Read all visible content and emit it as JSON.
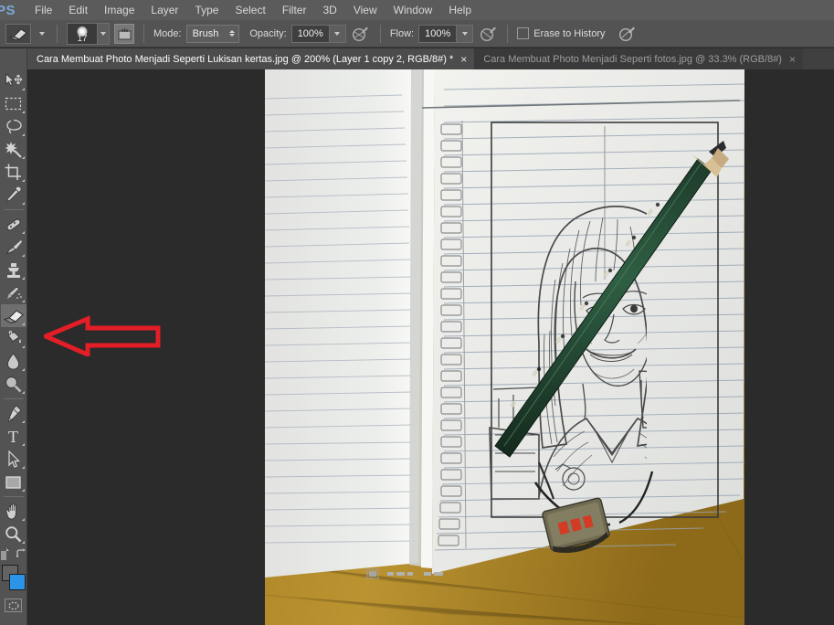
{
  "app": {
    "name": "Adobe Photoshop",
    "logo_text": "PS"
  },
  "menubar": {
    "items": [
      {
        "label": "File"
      },
      {
        "label": "Edit"
      },
      {
        "label": "Image"
      },
      {
        "label": "Layer"
      },
      {
        "label": "Type"
      },
      {
        "label": "Select"
      },
      {
        "label": "Filter"
      },
      {
        "label": "3D"
      },
      {
        "label": "View"
      },
      {
        "label": "Window"
      },
      {
        "label": "Help"
      }
    ]
  },
  "options_bar": {
    "tool": "eraser-tool",
    "brush_size": "17",
    "mode_label": "Mode:",
    "mode_value": "Brush",
    "opacity_label": "Opacity:",
    "opacity_value": "100%",
    "flow_label": "Flow:",
    "flow_value": "100%",
    "erase_to_history_label": "Erase to History",
    "erase_to_history_checked": false
  },
  "tabs": [
    {
      "title": "Cara Membuat Photo Menjadi Seperti Lukisan kertas.jpg @ 200% (Layer 1 copy 2, RGB/8#) *",
      "active": true,
      "close_glyph": "×"
    },
    {
      "title": "Cara Membuat Photo Menjadi Seperti fotos.jpg @ 33.3% (RGB/8#)",
      "active": false,
      "close_glyph": "×"
    }
  ],
  "toolbar": {
    "tools": [
      {
        "name": "move-tool",
        "selected": false
      },
      {
        "name": "rectangular-marquee-tool",
        "selected": false
      },
      {
        "name": "lasso-tool",
        "selected": false
      },
      {
        "name": "magic-wand-tool",
        "selected": false
      },
      {
        "name": "crop-tool",
        "selected": false
      },
      {
        "name": "eyedropper-tool",
        "selected": false
      },
      {
        "name": "spot-healing-brush-tool",
        "selected": false
      },
      {
        "name": "brush-tool",
        "selected": false
      },
      {
        "name": "clone-stamp-tool",
        "selected": false
      },
      {
        "name": "history-brush-tool",
        "selected": false
      },
      {
        "name": "eraser-tool",
        "selected": true
      },
      {
        "name": "gradient-tool",
        "selected": false
      },
      {
        "name": "blur-tool",
        "selected": false
      },
      {
        "name": "dodge-tool",
        "selected": false
      },
      {
        "name": "pen-tool",
        "selected": false
      },
      {
        "name": "horizontal-type-tool",
        "selected": false
      },
      {
        "name": "path-selection-tool",
        "selected": false
      },
      {
        "name": "rectangle-tool",
        "selected": false
      },
      {
        "name": "hand-tool",
        "selected": false
      },
      {
        "name": "zoom-tool",
        "selected": false
      }
    ],
    "type_tool_glyph": "T",
    "foreground_color": "#636363",
    "background_color": "#2b93e8"
  },
  "canvas": {
    "description": "Photo of an open ruled spiral notebook on a wooden desk, showing a pencil-sketch style portrait of a smiling young woman with long hair; a dark green pencil and a small eraser rest on the page.",
    "zoom": "200%",
    "paper_color": "#e8e9e6",
    "desk_color": "#a97f27",
    "rule_color": "#9aa6b4"
  },
  "annotation": {
    "type": "arrow",
    "direction": "left",
    "color": "#e41e26",
    "points_at": "eraser-tool"
  }
}
